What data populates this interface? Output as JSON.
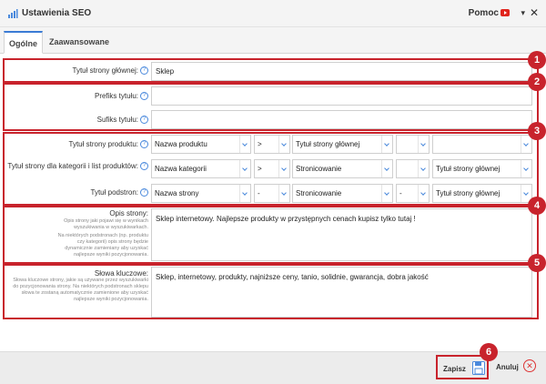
{
  "window": {
    "title": "Ustawienia SEO",
    "help_label": "Pomoc",
    "chevron": "▾",
    "close": "✕"
  },
  "tabs": [
    {
      "label": "Ogólne",
      "active": true
    },
    {
      "label": "Zaawansowane",
      "active": false
    }
  ],
  "form": {
    "home_title": {
      "label": "Tytuł strony głównej:",
      "value": "Sklep"
    },
    "prefix": {
      "label": "Prefiks tytułu:",
      "value": ""
    },
    "suffix": {
      "label": "Sufiks tytułu:",
      "value": ""
    },
    "product_title": {
      "label": "Tytuł strony produktu:",
      "sel1": "Nazwa produktu",
      "sep1": ">",
      "sel2": "Tytuł strony głównej",
      "sep2": "",
      "sel3": ""
    },
    "category_title": {
      "label": "Tytuł strony dla kategorii i list produktów:",
      "sel1": "Nazwa kategorii",
      "sep1": ">",
      "sel2": "Stronicowanie",
      "sep2": "",
      "sel3": "Tytuł strony głównej"
    },
    "subpage_title": {
      "label": "Tytuł podstron:",
      "sel1": "Nazwa strony",
      "sep1": "-",
      "sel2": "Stronicowanie",
      "sep2": "-",
      "sel3": "Tytuł strony głównej"
    },
    "description": {
      "label": "Opis strony:",
      "help1": "Opis strony jaki pojawi się w wynikach wyszukiwania w wyszukiwarkach.",
      "help2": "Na niektórych podstronach (np. produktu czy kategorii) opis strony będzie dynamicznie zamieniany aby uzyskać najlepsze wyniki pozycjonowania.",
      "value": "Sklep internetowy. Najlepsze produkty w przystępnych cenach kupisz tylko tutaj !"
    },
    "keywords": {
      "label": "Słowa kluczowe:",
      "help": "Słowa kluczowe strony, jakie są używane przez wyszukiwarki do pozycjonowania strony. Na niektórych podstronach sklepu słowa te zostaną automatycznie zamienione aby uzyskać najlepsze wyniki pozycjonowania.",
      "value": "Sklep, internetowy, produkty, najniższe ceny, tanio, solidnie, gwarancja, dobra jakość"
    }
  },
  "badges": [
    "1",
    "2",
    "3",
    "4",
    "5",
    "6"
  ],
  "footer": {
    "save_label": "Zapisz",
    "cancel_label": "Anuluj"
  },
  "colors": {
    "annotation_red": "#c8232c",
    "accent_blue": "#4a89dc"
  },
  "icons": [
    "bar-chart-icon",
    "youtube-icon",
    "help-icon",
    "dropdown-arrow-icon",
    "save-disk-icon",
    "cancel-circle-icon"
  ]
}
